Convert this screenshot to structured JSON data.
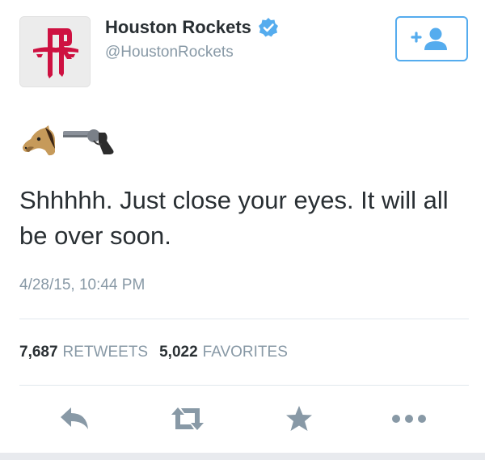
{
  "author": {
    "display_name": "Houston Rockets",
    "handle": "@HoustonRockets",
    "verified": true,
    "avatar_icon": "houston-rockets-logo",
    "brand_color": "#ce1141"
  },
  "follow_button": {
    "icon": "follow-add-user-icon",
    "color": "#55acee"
  },
  "tweet": {
    "emojis": [
      "horse-face-emoji",
      "pistol-emoji"
    ],
    "text": "Shhhhh. Just close your eyes. It will all be over soon.",
    "timestamp": "4/28/15, 10:44 PM"
  },
  "stats": {
    "retweets_count": "7,687",
    "retweets_label": "RETWEETS",
    "favorites_count": "5,022",
    "favorites_label": "FAVORITES"
  },
  "actions": {
    "icons": [
      "reply-icon",
      "retweet-icon",
      "favorite-star-icon",
      "more-icon"
    ],
    "color": "#8899a6"
  }
}
